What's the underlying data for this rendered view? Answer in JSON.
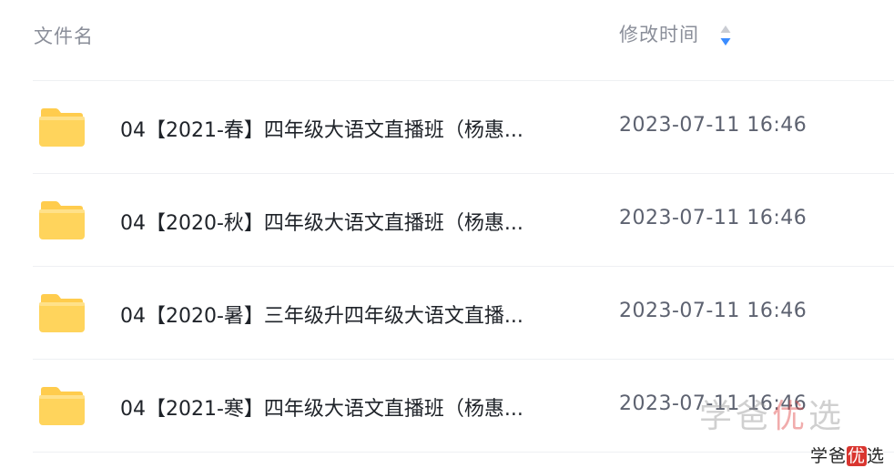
{
  "header": {
    "name_label": "文件名",
    "time_label": "修改时间",
    "sort_icon": "sort-icon"
  },
  "files": [
    {
      "name": "04【2021-春】四年级大语文直播班（杨惠...",
      "time": "2023-07-11 16:46",
      "icon": "folder-icon"
    },
    {
      "name": "04【2020-秋】四年级大语文直播班（杨惠...",
      "time": "2023-07-11 16:46",
      "icon": "folder-icon"
    },
    {
      "name": "04【2020-暑】三年级升四年级大语文直播...",
      "time": "2023-07-11 16:46",
      "icon": "folder-icon"
    },
    {
      "name": "04【2021-寒】四年级大语文直播班（杨惠...",
      "time": "2023-07-11 16:46",
      "icon": "folder-icon"
    }
  ],
  "watermark": {
    "large_a": "学爸",
    "large_b": "优",
    "large_c": "选",
    "small_a": "学爸",
    "small_b": "优",
    "small_c": "选"
  },
  "colors": {
    "folder_top": "#ffd76a",
    "folder_bottom": "#ffc53d",
    "sort_active": "#3b8cff",
    "sort_inactive": "#c9ccd3"
  }
}
